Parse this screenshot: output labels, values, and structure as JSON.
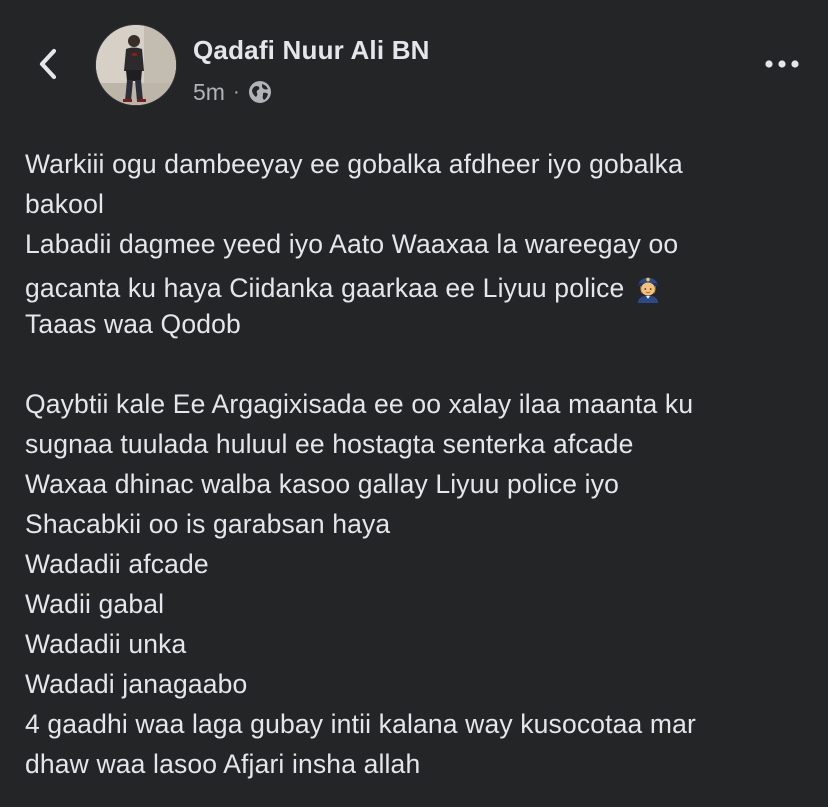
{
  "header": {
    "author_name": "Qadafi Nuur Ali BN",
    "timestamp": "5m",
    "separator": "·",
    "privacy_icon": "globe-icon",
    "back_icon": "chevron-left-icon",
    "more_icon": "more-horizontal-icon"
  },
  "post": {
    "lines": [
      "Warkiii ogu dambeeyay ee gobalka afdheer iyo gobalka",
      "bakool",
      "Labadii dagmee yeed iyo Aato Waaxaa la wareegay oo",
      "gacanta ku haya Ciidanka gaarkaa ee Liyuu police",
      "Taaas waa Qodob",
      "",
      "Qaybtii kale Ee Argagixisada ee oo xalay ilaa maanta ku",
      "sugnaa tuulada huluul ee hostagta senterka afcade",
      "Waxaa dhinac walba kasoo gallay Liyuu police iyo",
      "Shacabkii oo is garabsan haya",
      "Wadadii afcade",
      "Wadii gabal",
      "Wadadii unka",
      "Wadadi janagaabo",
      "4 gaadhi waa laga gubay intii kalana way kusocotaa mar",
      "dhaw waa lasoo Afjari insha allah"
    ],
    "emoji": "police-officer-emoji"
  },
  "colors": {
    "background": "#242526",
    "primary_text": "#e4e6eb",
    "secondary_text": "#b0b3b8"
  }
}
